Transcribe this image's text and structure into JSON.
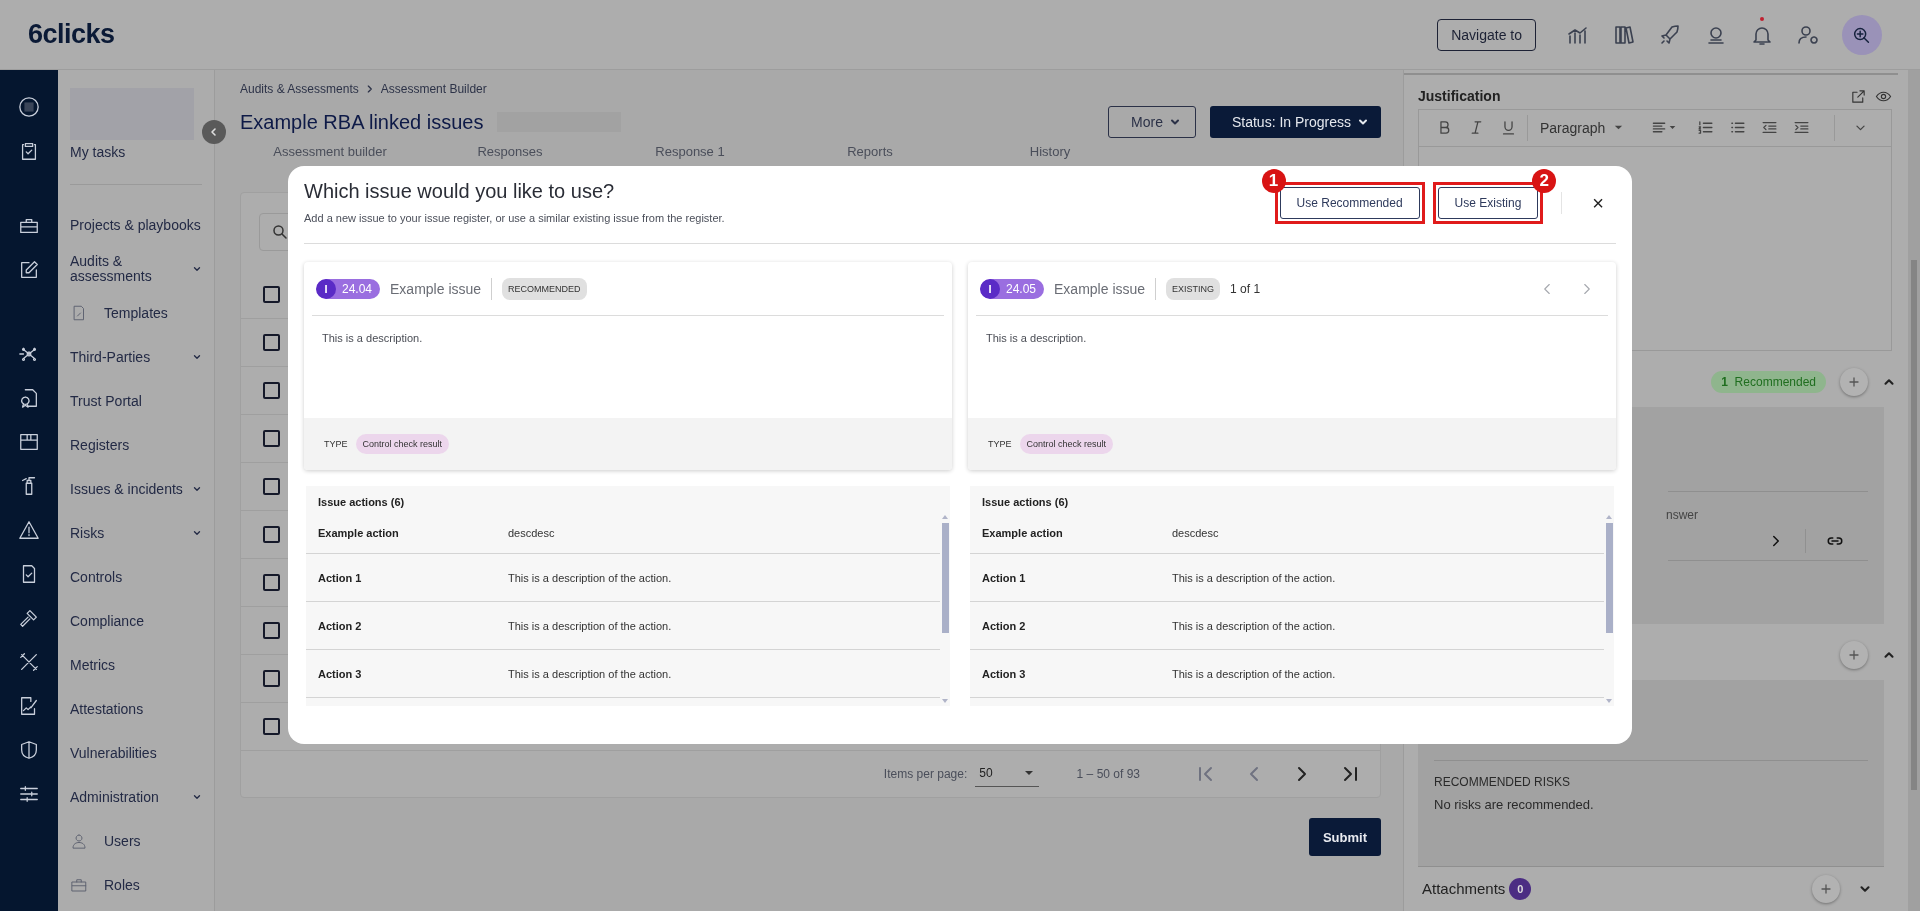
{
  "header": {
    "logo": "6clicks",
    "navigate_button": "Navigate to",
    "notification_dot": true
  },
  "nav": {
    "items": [
      {
        "label": "My tasks",
        "expandable": false
      },
      {
        "label": "Projects & playbooks",
        "expandable": false
      },
      {
        "label": "Audits & assessments",
        "expandable": true,
        "children": [
          {
            "label": "Templates"
          }
        ]
      },
      {
        "label": "Third-Parties",
        "expandable": true
      },
      {
        "label": "Trust Portal",
        "expandable": false
      },
      {
        "label": "Registers",
        "expandable": false
      },
      {
        "label": "Issues & incidents",
        "expandable": true
      },
      {
        "label": "Risks",
        "expandable": true
      },
      {
        "label": "Controls",
        "expandable": false
      },
      {
        "label": "Compliance",
        "expandable": false
      },
      {
        "label": "Metrics",
        "expandable": false
      },
      {
        "label": "Attestations",
        "expandable": false
      },
      {
        "label": "Vulnerabilities",
        "expandable": false
      },
      {
        "label": "Administration",
        "expandable": true,
        "children": [
          {
            "label": "Users"
          },
          {
            "label": "Roles"
          }
        ]
      }
    ]
  },
  "breadcrumb": [
    "Audits & Assessments",
    "Assessment Builder"
  ],
  "page_title": "Example RBA linked issues",
  "actions": {
    "more": "More",
    "status": "Status: In Progress"
  },
  "tabs": [
    {
      "label": "Assessment builder"
    },
    {
      "label": "Responses"
    },
    {
      "label": "Response 1"
    },
    {
      "label": "Reports"
    },
    {
      "label": "History"
    }
  ],
  "table": {
    "rows": [
      {
        "checked": false
      },
      {
        "checked": false
      },
      {
        "checked": false
      },
      {
        "checked": false
      },
      {
        "checked": false
      },
      {
        "checked": false
      },
      {
        "checked": false
      },
      {
        "checked": false
      },
      {
        "checked": false
      },
      {
        "checked": false
      }
    ]
  },
  "pagination": {
    "items_per_page_label": "Items per page:",
    "page_size": "50",
    "range": "1 – 50 of 93"
  },
  "submit": "Submit",
  "right_panel": {
    "justification": "Justification",
    "block_style": "Paragraph",
    "recommended_count": "1",
    "recommended_label": "Recommended",
    "fragment": "nswer",
    "risks_heading": "RECOMMENDED RISKS",
    "risks_empty": "No risks are recommended.",
    "attachments": "Attachments",
    "attachments_count": "0"
  },
  "modal": {
    "title": "Which issue would you like to use?",
    "subtitle": "Add a new issue to your issue register, or use a similar existing issue from the register.",
    "buttons": [
      {
        "label": "Use Recommended",
        "marker": "1"
      },
      {
        "label": "Use Existing",
        "marker": "2"
      }
    ],
    "close": "×",
    "issues": [
      {
        "tag_letter": "I",
        "number": "24.04",
        "name": "Example issue",
        "chip": "RECOMMENDED",
        "description": "This is a description.",
        "type_label": "TYPE",
        "type": "Control check result",
        "actions_title": "Issue actions (6)",
        "actions": [
          {
            "name": "Example action",
            "description": "descdesc"
          },
          {
            "name": "Action 1",
            "description": "This is a description of the action."
          },
          {
            "name": "Action 2",
            "description": "This is a description of the action."
          },
          {
            "name": "Action 3",
            "description": "This is a description of the action."
          }
        ]
      },
      {
        "tag_letter": "I",
        "number": "24.05",
        "name": "Example issue",
        "chip": "EXISTING",
        "pager": "1 of 1",
        "description": "This is a description.",
        "type_label": "TYPE",
        "type": "Control check result",
        "actions_title": "Issue actions (6)",
        "actions": [
          {
            "name": "Example action",
            "description": "descdesc"
          },
          {
            "name": "Action 1",
            "description": "This is a description of the action."
          },
          {
            "name": "Action 2",
            "description": "This is a description of the action."
          },
          {
            "name": "Action 3",
            "description": "This is a description of the action."
          }
        ]
      }
    ]
  }
}
